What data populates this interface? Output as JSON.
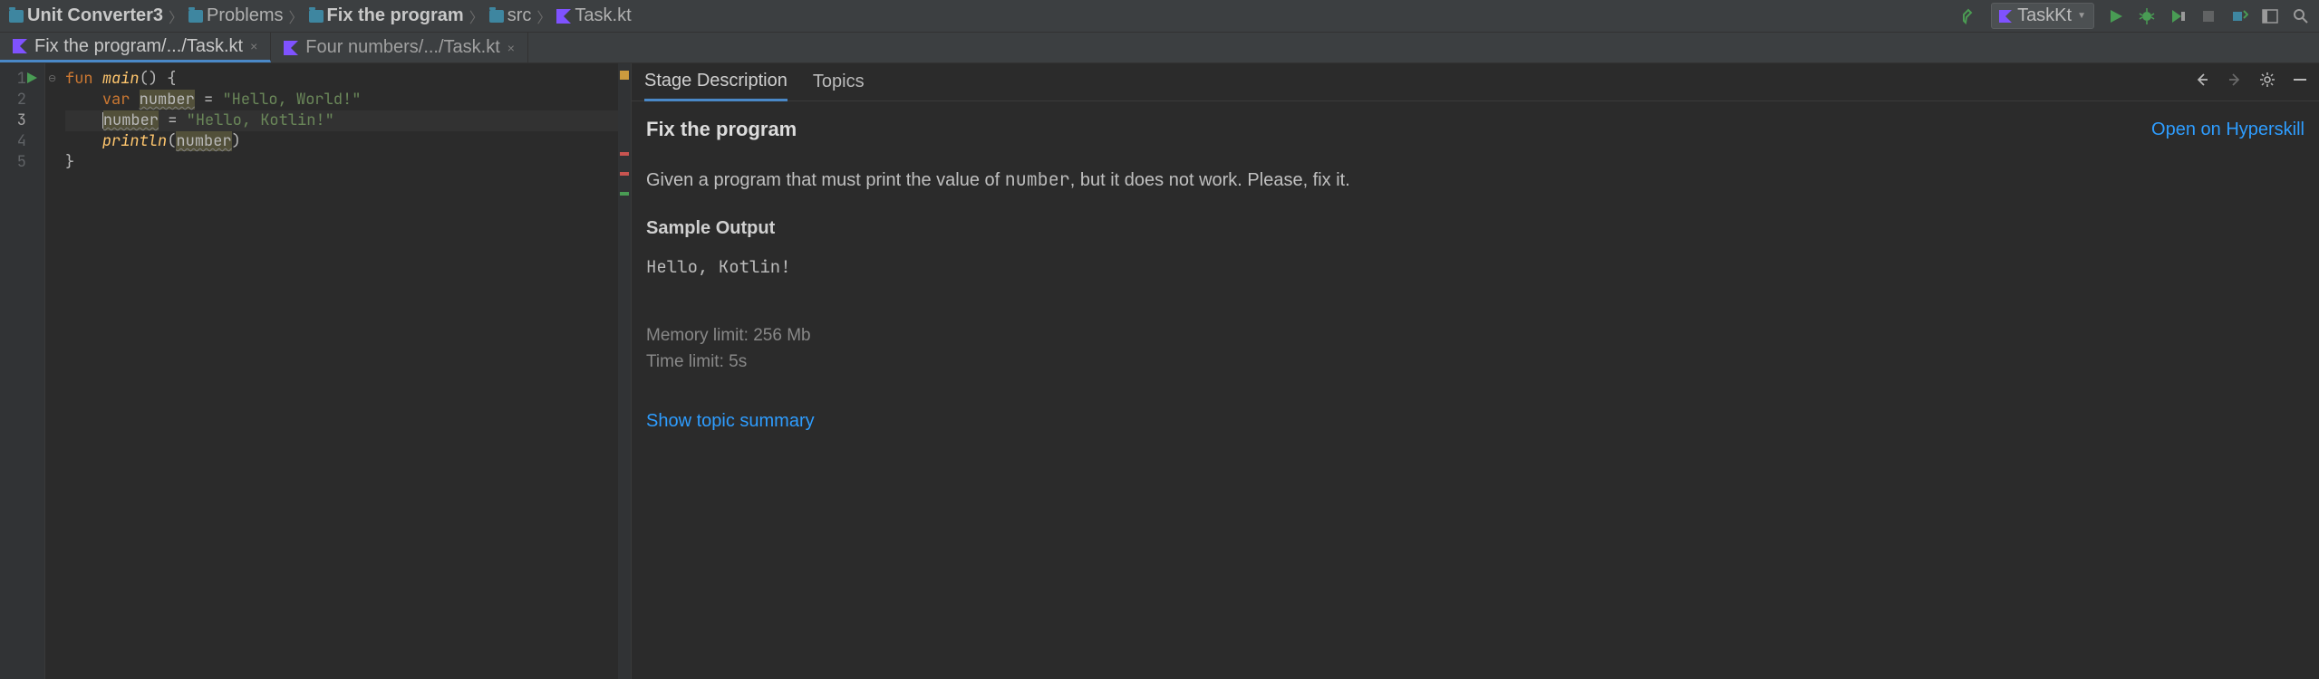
{
  "breadcrumbs": {
    "items": [
      {
        "label": "Unit Converter3",
        "bold": true
      },
      {
        "label": "Problems"
      },
      {
        "label": "Fix the program",
        "bold": true
      },
      {
        "label": "src"
      },
      {
        "label": "Task.kt"
      }
    ]
  },
  "run_config": {
    "label": "TaskKt"
  },
  "editor_tabs": {
    "tab1": "Fix the program/.../Task.kt",
    "tab2": "Four numbers/.../Task.kt"
  },
  "code": {
    "l1": {
      "kw": "fun ",
      "fn": "main",
      "rest": "() {"
    },
    "l2": {
      "kw": "var ",
      "ident": "number",
      "eq": " = ",
      "str": "\"Hello, World!\""
    },
    "l3": {
      "ident": "number",
      "eq": " = ",
      "str": "\"Hello, Kotlin!\""
    },
    "l4": {
      "fn": "println",
      "open": "(",
      "ident": "number",
      "close": ")"
    },
    "l5": {
      "text": "}"
    }
  },
  "line_numbers": {
    "l1": "1",
    "l2": "2",
    "l3": "3",
    "l4": "4",
    "l5": "5"
  },
  "task_tabs": {
    "desc": "Stage Description",
    "topics": "Topics"
  },
  "task": {
    "title": "Fix the program",
    "hyperskill": "Open on Hyperskill",
    "para_before": "Given a program that must print the value of ",
    "para_code": "number",
    "para_after": ", but it does not work. Please, fix it.",
    "sample_title": "Sample Output",
    "sample_code": "Hello, Kotlin!",
    "mem_limit": "Memory limit: 256 Mb",
    "time_limit": "Time limit: 5s",
    "topic_link": "Show topic summary"
  }
}
